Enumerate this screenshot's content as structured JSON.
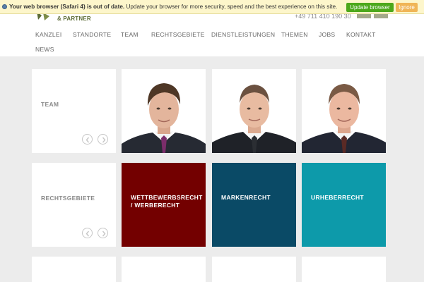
{
  "header": {
    "logo_text": "& PARTNER",
    "phone": "+49 711 410 190 30"
  },
  "nav": {
    "items": [
      "KANZLEI",
      "STANDORTE",
      "TEAM",
      "RECHTSGEBIETE",
      "DIENSTLEISTUNGEN",
      "THEMEN",
      "JOBS",
      "KONTAKT",
      "NEWS"
    ]
  },
  "browser_warning": {
    "bold_text": "Your web browser (Safari 4) is out of date.",
    "text": " Update your browser for more security, speed and the best experience on this site.",
    "update_label": "Update browser",
    "ignore_label": "Ignore"
  },
  "tiles": {
    "team_label": "TEAM",
    "rechtsgebiete_label": "RECHTSGEBIETE",
    "areas": [
      {
        "label": "WETTBEWERBSRECHT / WERBERECHT",
        "color": "#730000"
      },
      {
        "label": "MARKENRECHT",
        "color": "#0a4a66"
      },
      {
        "label": "URHEBERRECHT",
        "color": "#0d9aaa"
      }
    ]
  },
  "colors": {
    "background": "#ececec",
    "logo_green": "#5c6b36",
    "update_green": "#4da81b",
    "ignore_orange": "#f0b557"
  },
  "icons": [
    "info-icon",
    "chevron-left-icon",
    "chevron-right-icon"
  ]
}
